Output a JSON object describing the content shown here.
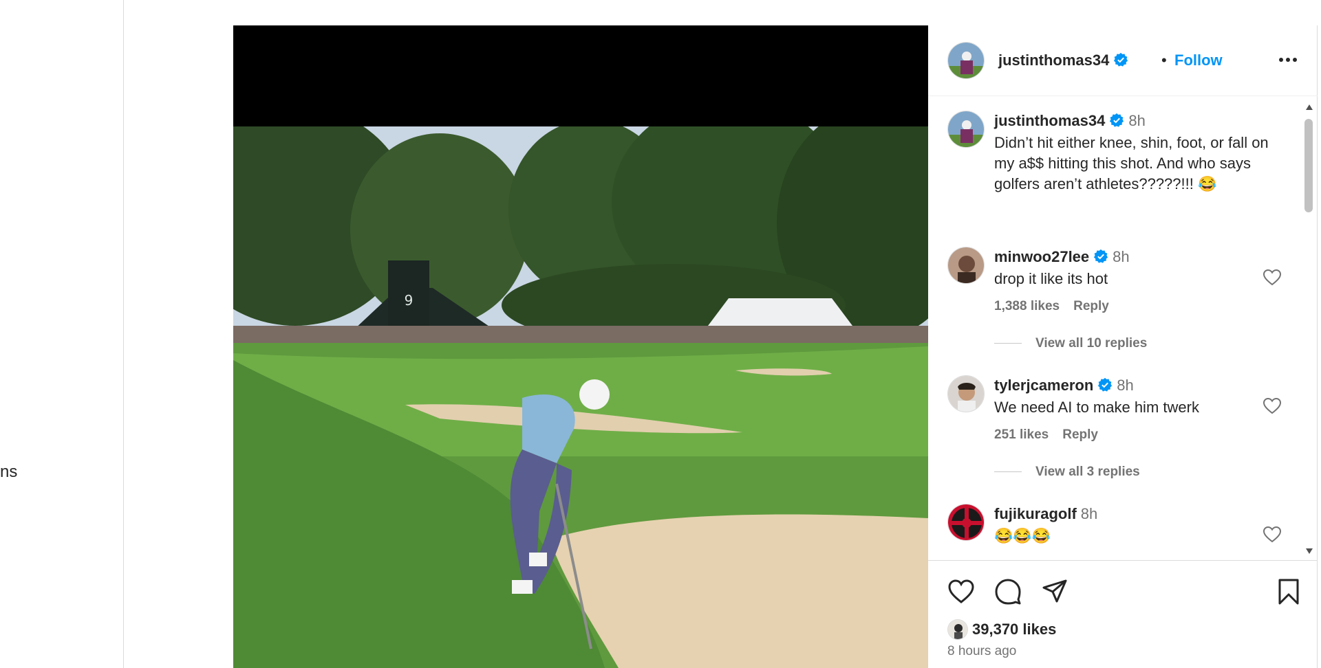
{
  "sidebar": {
    "partial_label": "ns"
  },
  "post": {
    "author": "justinthomas34",
    "follow_label": "Follow",
    "dot": "•",
    "caption": {
      "user": "justinthomas34",
      "time": "8h",
      "text": "Didn’t hit either knee, shin, foot, or fall on my a$$ hitting this shot. And who says golfers aren’t athletes?????!!! 😂"
    },
    "comments": [
      {
        "user": "minwoo27lee",
        "verified": true,
        "time": "8h",
        "text": "drop it like its hot",
        "likes": "1,388 likes",
        "reply": "Reply",
        "view_replies": "View all 10 replies"
      },
      {
        "user": "tylerjcameron",
        "verified": true,
        "time": "8h",
        "text": "We need AI to make him twerk",
        "likes": "251 likes",
        "reply": "Reply",
        "view_replies": "View all 3 replies"
      },
      {
        "user": "fujikuragolf",
        "verified": false,
        "time": "8h",
        "text": "😂😂😂"
      }
    ],
    "likes": "39,370 likes",
    "time_ago": "8 hours ago"
  },
  "icons": {
    "header": [
      "verified-icon",
      "more-options-icon"
    ],
    "actions": [
      "heart-icon",
      "comment-icon",
      "share-icon",
      "bookmark-icon"
    ]
  },
  "colors": {
    "follow": "#0095f6",
    "verified": "#0095f6",
    "muted": "#737373"
  }
}
